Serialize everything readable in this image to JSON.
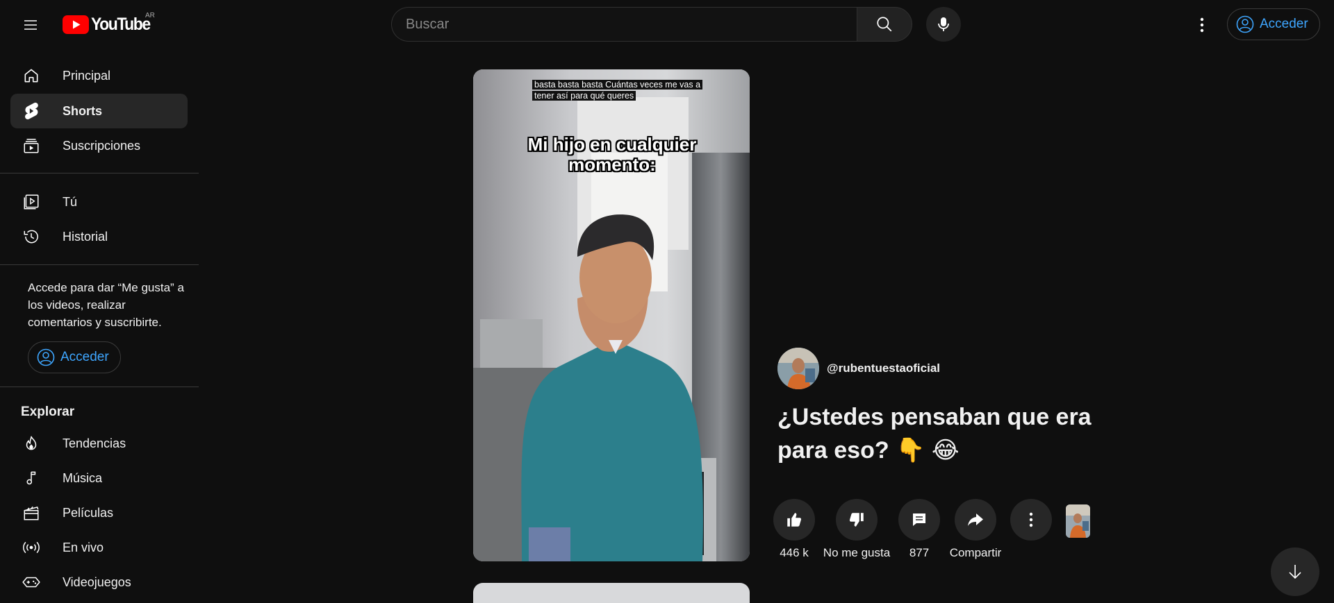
{
  "header": {
    "logo_text": "YouTube",
    "country_code": "AR",
    "search_placeholder": "Buscar",
    "signin_label": "Acceder"
  },
  "sidebar": {
    "main_items": [
      {
        "label": "Principal",
        "icon": "home-icon"
      },
      {
        "label": "Shorts",
        "icon": "shorts-icon",
        "active": true
      },
      {
        "label": "Suscripciones",
        "icon": "subscriptions-icon"
      }
    ],
    "you_items": [
      {
        "label": "Tú",
        "icon": "you-icon"
      },
      {
        "label": "Historial",
        "icon": "history-icon"
      }
    ],
    "signin_message": "Accede para dar “Me gusta” a los videos, realizar comentarios y suscribirte.",
    "signin_label": "Acceder",
    "explore_title": "Explorar",
    "explore_items": [
      {
        "label": "Tendencias",
        "icon": "trending-icon"
      },
      {
        "label": "Música",
        "icon": "music-icon"
      },
      {
        "label": "Películas",
        "icon": "movies-icon"
      },
      {
        "label": "En vivo",
        "icon": "live-icon"
      },
      {
        "label": "Videojuegos",
        "icon": "gaming-icon"
      }
    ]
  },
  "short": {
    "caption": "basta basta basta Cuántas veces me vas a tener así para qué queres",
    "overlay_text": "Mi hijo en cualquier momento:",
    "channel": "@rubentuestaoficial",
    "title": "¿Ustedes pensaban que era para eso? 👇 😂",
    "likes": "446 k",
    "dislike_label": "No me gusta",
    "comments": "877",
    "share_label": "Compartir"
  },
  "colors": {
    "background": "#0f0f0f",
    "accent_blue": "#3ea6ff",
    "youtube_red": "#ff0000",
    "surface": "#272727"
  }
}
